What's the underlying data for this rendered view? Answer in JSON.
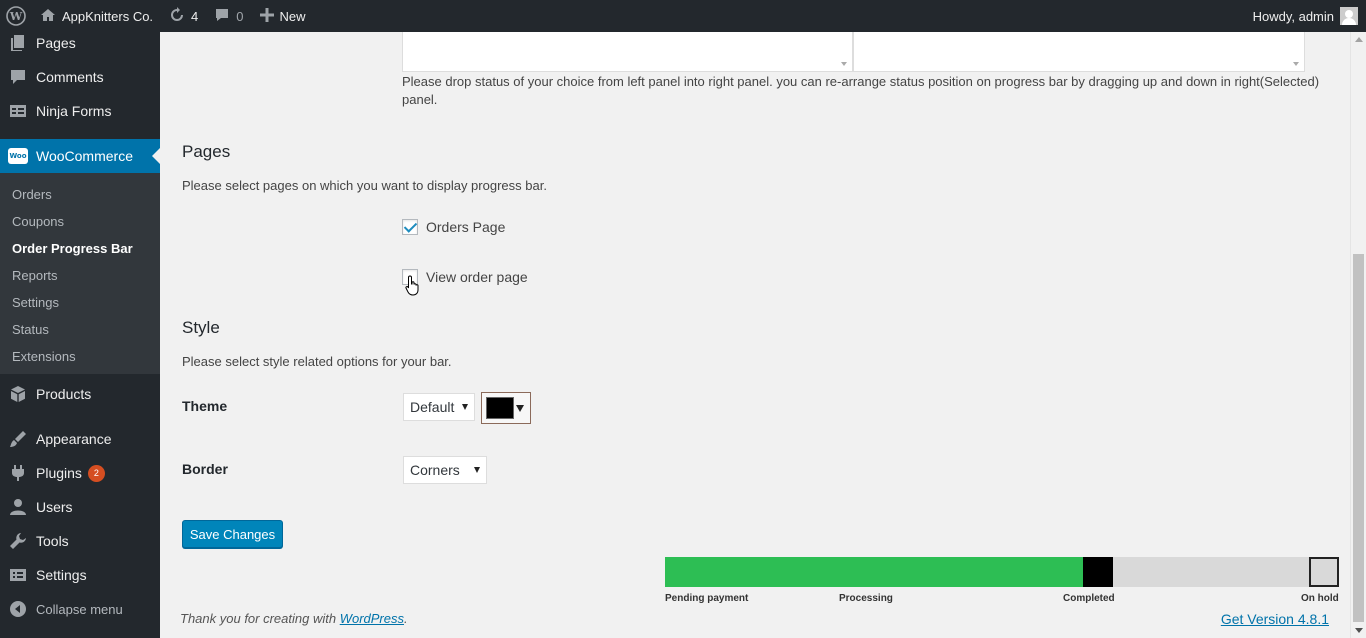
{
  "adminbar": {
    "site_name": "AppKnitters Co.",
    "updates_count": "4",
    "comments_count": "0",
    "new_label": "New",
    "howdy": "Howdy, admin"
  },
  "sidebar": {
    "items": [
      {
        "label": "Pages",
        "icon": "pages-icon"
      },
      {
        "label": "Comments",
        "icon": "comments-icon"
      },
      {
        "label": "Ninja Forms",
        "icon": "ninja-forms-icon"
      },
      {
        "label": "WooCommerce",
        "icon": "woocommerce-icon"
      },
      {
        "label": "Products",
        "icon": "products-icon"
      },
      {
        "label": "Appearance",
        "icon": "appearance-icon"
      },
      {
        "label": "Plugins",
        "icon": "plugins-icon",
        "badge": "2"
      },
      {
        "label": "Users",
        "icon": "users-icon"
      },
      {
        "label": "Tools",
        "icon": "tools-icon"
      },
      {
        "label": "Settings",
        "icon": "settings-icon"
      }
    ],
    "woo_icon_text": "Woo",
    "submenu": [
      "Orders",
      "Coupons",
      "Order Progress Bar",
      "Reports",
      "Settings",
      "Status",
      "Extensions"
    ],
    "collapse": "Collapse menu"
  },
  "main": {
    "status_help": "Please drop status of your choice from left panel into right panel. you can re-arrange status position on progress bar by dragging up and down in right(Selected) panel.",
    "pages": {
      "title": "Pages",
      "desc": "Please select pages on which you want to display progress bar.",
      "orders_page": "Orders Page",
      "orders_page_checked": true,
      "view_order_page": "View order page",
      "view_order_page_checked": false
    },
    "style": {
      "title": "Style",
      "desc": "Please select style related options for your bar.",
      "theme_label": "Theme",
      "theme_value": "Default",
      "color_value": "#000000",
      "border_label": "Border",
      "border_value": "Corners"
    },
    "save_label": "Save Changes"
  },
  "progress_bar": {
    "steps": [
      "Pending payment",
      "Processing",
      "Completed",
      "On hold"
    ],
    "fill_color": "#2dbe54",
    "track_color": "#d9d9d9",
    "fill_fraction": 0.62
  },
  "footer": {
    "thanks_prefix": "Thank you for creating with ",
    "thanks_link": "WordPress",
    "thanks_suffix": ".",
    "version_link": "Get Version 4.8.1"
  }
}
